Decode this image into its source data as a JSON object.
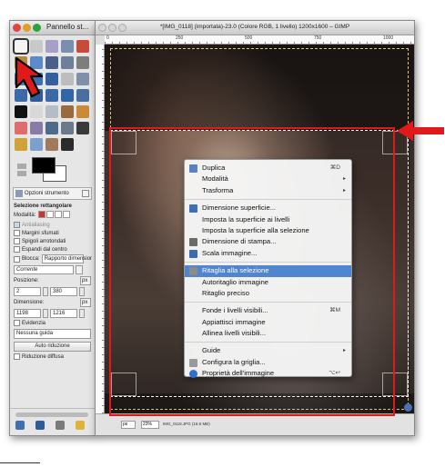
{
  "toolbox": {
    "title": "Pannello st...",
    "tool_options_tab": "Opzioni strumento",
    "section_title": "Selezione rettangolare",
    "mode_label": "Modalità:",
    "antialiasing": "Antialiasing",
    "feather_edges": "Margini sfumati",
    "rounded_corners": "Spigoli arrotondati",
    "expand_from_center": "Espandi dal centro",
    "fixed_label": "Blocca:",
    "fixed_value": "Rapporto dimensior",
    "current_value": "Corrente",
    "position_label": "Posizione:",
    "position_x": "2",
    "position_y": "380",
    "position_unit": "px",
    "size_label": "Dimensione:",
    "size_w": "1198",
    "size_h": "1216",
    "size_unit": "px",
    "highlight": "Evidenzia",
    "guide_value": "Nessuna guida",
    "auto_shrink": "Auto riduzione",
    "shrink_merged": "Riduzione diffusa",
    "colors": {
      "foreground": "#000000",
      "background": "#ffffff"
    }
  },
  "image_window": {
    "title": "*[IMG_0118] (importata)-23.0 (Colore RGB, 1 livello) 1200x1600 – GIMP",
    "ruler_marks": [
      "0",
      "250",
      "500",
      "750",
      "1000"
    ],
    "status_unit": "px",
    "status_zoom": "23%",
    "status_text": "IMG_0118.JPG (16.6 MB)"
  },
  "context_menu": {
    "items": [
      {
        "label": "Duplica",
        "icon": "duplicate-icon",
        "shortcut": "⌘D"
      },
      {
        "label": "Modalità",
        "submenu": true
      },
      {
        "label": "Trasforma",
        "submenu": true
      },
      {
        "separator": true
      },
      {
        "label": "Dimensione superficie...",
        "icon": "canvas-size-icon"
      },
      {
        "label": "Imposta la superficie ai livelli"
      },
      {
        "label": "Imposta la superficie alla selezione"
      },
      {
        "label": "Dimensione di stampa...",
        "icon": "print-size-icon"
      },
      {
        "label": "Scala immagine...",
        "icon": "scale-image-icon"
      },
      {
        "separator": true
      },
      {
        "label": "Ritaglia alla selezione",
        "icon": "crop-icon",
        "highlighted": true
      },
      {
        "label": "Autoritaglio immagine"
      },
      {
        "label": "Ritaglio preciso"
      },
      {
        "separator": true
      },
      {
        "label": "Fonde i livelli visibili...",
        "shortcut": "⌘M"
      },
      {
        "label": "Appiattisci immagine"
      },
      {
        "label": "Allinea livelli visibili..."
      },
      {
        "separator": true
      },
      {
        "label": "Guide",
        "submenu": true
      },
      {
        "label": "Configura la griglia...",
        "icon": "grid-icon"
      },
      {
        "label": "Proprietà dell'immagine",
        "icon": "info-icon",
        "shortcut": "⌥↩"
      }
    ],
    "submenu_glyph": "▸"
  },
  "annotation_colors": {
    "highlight_red": "#e01a1a"
  }
}
